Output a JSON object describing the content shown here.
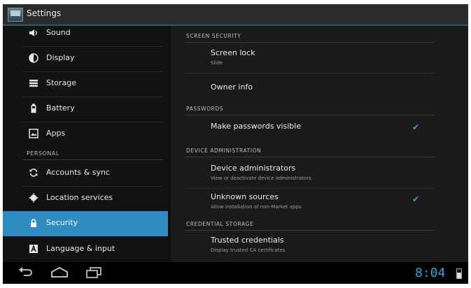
{
  "window": {
    "title": "Settings"
  },
  "sidebar": {
    "items": [
      {
        "label": "Sound",
        "icon": "speaker-icon"
      },
      {
        "label": "Display",
        "icon": "brightness-icon"
      },
      {
        "label": "Storage",
        "icon": "storage-icon"
      },
      {
        "label": "Battery",
        "icon": "battery-icon"
      },
      {
        "label": "Apps",
        "icon": "apps-icon"
      }
    ],
    "section_personal": "PERSONAL",
    "personal_items": [
      {
        "label": "Accounts & sync",
        "icon": "sync-icon"
      },
      {
        "label": "Location services",
        "icon": "location-icon"
      },
      {
        "label": "Security",
        "icon": "lock-icon",
        "active": true
      },
      {
        "label": "Language & input",
        "icon": "language-icon"
      }
    ]
  },
  "content": {
    "sections": [
      {
        "header": "SCREEN SECURITY"
      },
      {
        "header": "PASSWORDS"
      },
      {
        "header": "DEVICE ADMINISTRATION"
      },
      {
        "header": "CREDENTIAL STORAGE"
      }
    ],
    "rows": {
      "screen_lock": {
        "title": "Screen lock",
        "subtitle": "Slide"
      },
      "owner_info": {
        "title": "Owner info"
      },
      "make_passwords_visible": {
        "title": "Make passwords visible",
        "checked": true
      },
      "device_administrators": {
        "title": "Device administrators",
        "subtitle": "View or deactivate device administrators"
      },
      "unknown_sources": {
        "title": "Unknown sources",
        "subtitle": "Allow installation of non-Market apps",
        "checked": true
      },
      "trusted_credentials": {
        "title": "Trusted credentials",
        "subtitle": "Display trusted CA certificates"
      }
    },
    "check_glyph": "✔"
  },
  "status_bar": {
    "time": "8:04"
  },
  "colors": {
    "accent": "#33a9e0",
    "active_item": "#2e8bc0",
    "background": "#1a1a1a"
  }
}
